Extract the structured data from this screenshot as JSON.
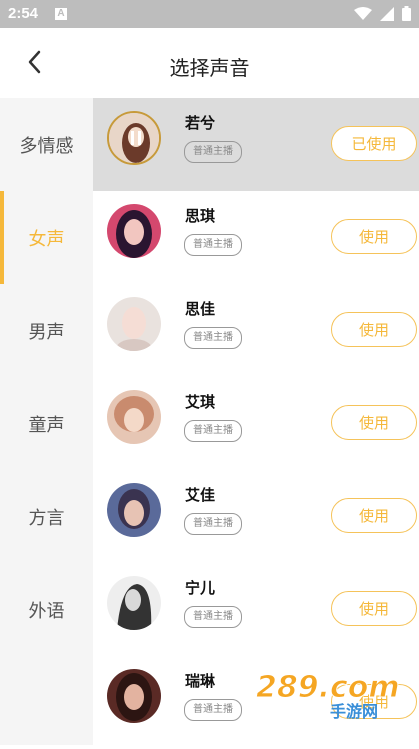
{
  "status": {
    "time": "2:54",
    "app_icon": "A"
  },
  "header": {
    "title": "选择声音"
  },
  "sidebar": {
    "items": [
      {
        "label": "多情感",
        "active": false
      },
      {
        "label": "女声",
        "active": true
      },
      {
        "label": "男声",
        "active": false
      },
      {
        "label": "童声",
        "active": false
      },
      {
        "label": "方言",
        "active": false
      },
      {
        "label": "外语",
        "active": false
      }
    ]
  },
  "voices": [
    {
      "name": "若兮",
      "tag": "普通主播",
      "button": "已使用",
      "selected": true
    },
    {
      "name": "思琪",
      "tag": "普通主播",
      "button": "使用",
      "selected": false
    },
    {
      "name": "思佳",
      "tag": "普通主播",
      "button": "使用",
      "selected": false
    },
    {
      "name": "艾琪",
      "tag": "普通主播",
      "button": "使用",
      "selected": false
    },
    {
      "name": "艾佳",
      "tag": "普通主播",
      "button": "使用",
      "selected": false
    },
    {
      "name": "宁儿",
      "tag": "普通主播",
      "button": "使用",
      "selected": false
    },
    {
      "name": "瑞琳",
      "tag": "普通主播",
      "button": "使用",
      "selected": false
    }
  ],
  "watermark": {
    "text": "289.com",
    "subtext": "手游网"
  },
  "colors": {
    "accent": "#f5b83a",
    "sidebar_bg": "#f5f5f5",
    "selected_row": "#dcdcdc",
    "statusbar": "#bdbdbd"
  }
}
